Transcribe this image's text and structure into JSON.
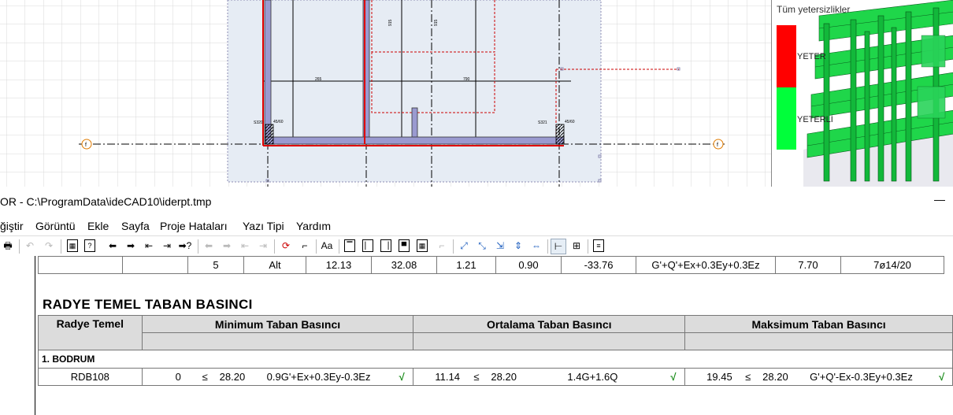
{
  "thumbnail": {
    "title": "Tüm yetersizlikler",
    "legend_red_label": "YETER",
    "legend_green_label": "YETERLİ",
    "colors": {
      "red": "#ff0000",
      "green": "#00ff3a"
    }
  },
  "cad_labels": {
    "dim_265": "265",
    "dim_790": "790",
    "dim_915a": "915",
    "dim_915b": "915",
    "axis_marker": "f",
    "s320": "S320",
    "s321": "S321",
    "s_label1": "45/60",
    "s_label2": "45/60"
  },
  "window": {
    "title": "OR - C:\\ProgramData\\ideCAD10\\iderpt.tmp",
    "minimize": "—"
  },
  "menu": [
    "ğiştir",
    "Görüntü",
    "Ekle",
    "Sayfa",
    "Proje Hataları",
    "Yazı Tipi",
    "Yardım"
  ],
  "previous_row": [
    "",
    "",
    "5",
    "Alt",
    "12.13",
    "32.08",
    "1.21",
    "0.90",
    "-33.76",
    "G'+Q'+Ex+0.3Ey+0.3Ez",
    "7.70",
    "7ø14/20"
  ],
  "section_title": "RADYE TEMEL TABAN BASINCI",
  "table": {
    "headers": {
      "col1": "Radye Temel",
      "col2": "Minimum Taban Basıncı",
      "col3": "Ortalama Taban Basıncı",
      "col4": "Maksimum Taban Basıncı"
    },
    "group": "1. BODRUM",
    "row": {
      "name": "RDB108",
      "min_value": "0",
      "min_op": "≤",
      "min_limit": "28.20",
      "min_combo": "0.9G'+Ex+0.3Ey-0.3Ez",
      "min_check": "√",
      "avg_value": "11.14",
      "avg_op": "≤",
      "avg_limit": "28.20",
      "avg_combo": "1.4G+1.6Q",
      "avg_check": "√",
      "max_value": "19.45",
      "max_op": "≤",
      "max_limit": "28.20",
      "max_combo": "G'+Q'-Ex-0.3Ey+0.3Ez",
      "max_check": "√"
    }
  }
}
